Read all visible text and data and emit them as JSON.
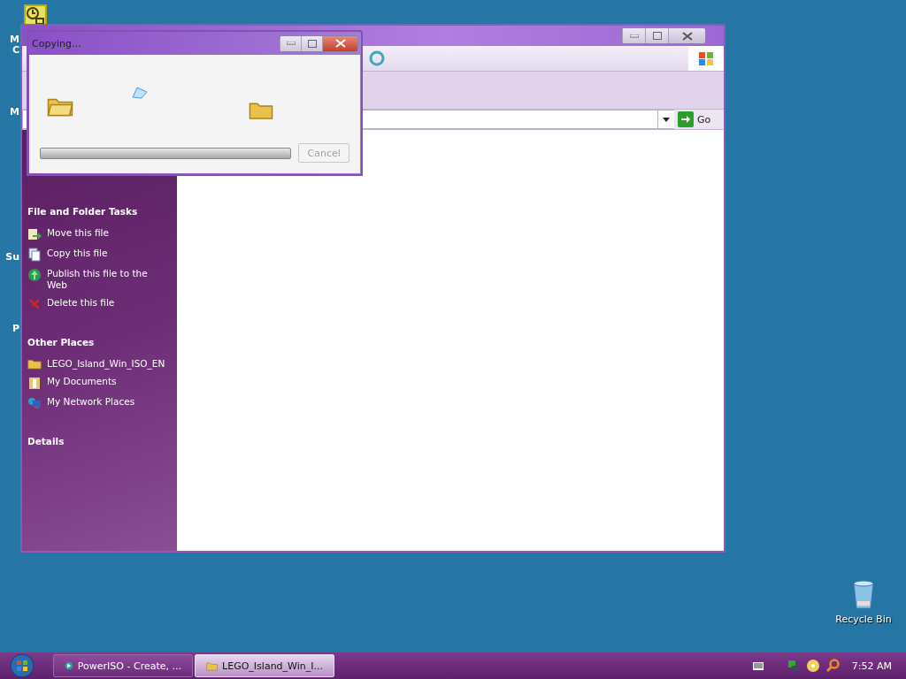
{
  "desktop": {
    "label_fragments": [
      "M",
      "C",
      "M",
      "Su",
      "P"
    ],
    "recycle_bin": "Recycle Bin"
  },
  "explorer": {
    "address": {
      "go": "Go"
    },
    "task_sections": [
      {
        "title": "File and Folder Tasks",
        "items": [
          {
            "label": "Move this file",
            "kind": "move"
          },
          {
            "label": "Copy this file",
            "kind": "copy"
          },
          {
            "label": "Publish this file to the Web",
            "kind": "publish"
          },
          {
            "label": "Delete this file",
            "kind": "delete"
          }
        ]
      },
      {
        "title": "Other Places",
        "items": [
          {
            "label": "LEGO_Island_Win_ISO_EN",
            "kind": "folder"
          },
          {
            "label": "My Documents",
            "kind": "documents"
          },
          {
            "label": "My Network Places",
            "kind": "network"
          }
        ]
      },
      {
        "title": "Details"
      }
    ]
  },
  "copy_dialog": {
    "title": "Copying...",
    "progress": {
      "level": 0
    },
    "cancel": {
      "label": "Cancel",
      "disabled": true
    }
  },
  "taskbar": {
    "buttons": [
      {
        "label": "PowerISO - Create, ...",
        "kind": "poweriso",
        "selected": false
      },
      {
        "label": "LEGO_Island_Win_I...",
        "kind": "folder",
        "selected": true
      }
    ],
    "clock": "7:52 AM"
  }
}
